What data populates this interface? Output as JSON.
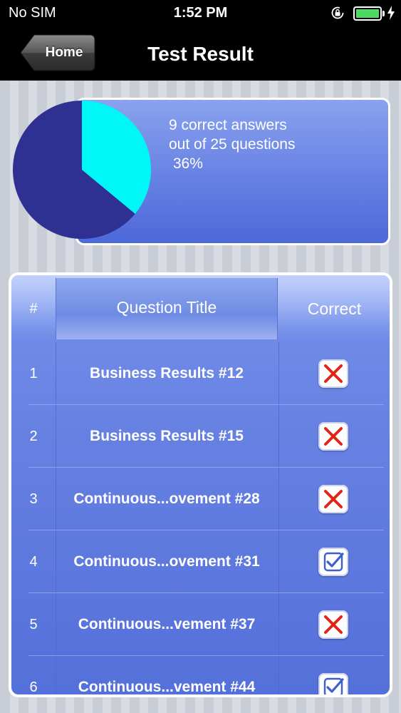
{
  "status_bar": {
    "carrier": "No SIM",
    "time": "1:52 PM",
    "icons": [
      "orientation-lock-icon",
      "battery-icon",
      "charging-bolt-icon"
    ],
    "battery_color": "#4cd964"
  },
  "nav": {
    "back_label": "Home",
    "title": "Test Result"
  },
  "summary": {
    "text": "9 correct answers\nout of 25 questions\n 36%",
    "correct": 9,
    "total": 25,
    "percent": 36,
    "pie_colors": {
      "correct": "#00f7f7",
      "incorrect": "#2e3192"
    }
  },
  "table": {
    "headers": {
      "num": "#",
      "title": "Question Title",
      "correct": "Correct"
    },
    "rows": [
      {
        "num": "1",
        "title": "Business Results #12",
        "correct": false
      },
      {
        "num": "2",
        "title": "Business Results #15",
        "correct": false
      },
      {
        "num": "3",
        "title": "Continuous...ovement #28",
        "correct": false
      },
      {
        "num": "4",
        "title": "Continuous...ovement #31",
        "correct": true
      },
      {
        "num": "5",
        "title": "Continuous...vement #37",
        "correct": false
      },
      {
        "num": "6",
        "title": "Continuous...vement #44",
        "correct": true
      }
    ],
    "colors": {
      "wrong": "#e2231a",
      "right": "#3a5fcf"
    }
  }
}
